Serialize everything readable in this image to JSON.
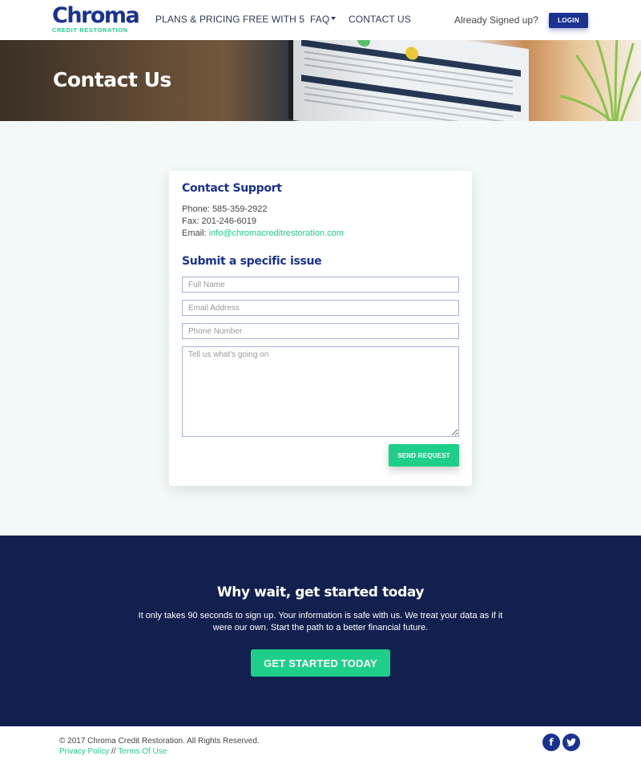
{
  "brand": {
    "name": "Chroma",
    "tagline": "CREDIT RESTORATION",
    "primary_color": "#1b3290",
    "accent_color": "#1ecf8a",
    "dark_color": "#13204f"
  },
  "nav": {
    "items": [
      {
        "label": "PLANS & PRICING"
      },
      {
        "label": "FREE WITH 5"
      },
      {
        "label": "FAQ",
        "has_dropdown": true
      },
      {
        "label": "CONTACT US"
      }
    ],
    "signed_up_text": "Already Signed up?",
    "login_label": "LOGIN"
  },
  "hero": {
    "title": "Contact Us"
  },
  "support": {
    "heading": "Contact Support",
    "phone_label": "Phone:",
    "phone": "585-359-2922",
    "fax_label": "Fax:",
    "fax": "201-246-6019",
    "email_label": "Email:",
    "email": "info@chromacreditrestoration.com"
  },
  "form": {
    "heading": "Submit a specific issue",
    "full_name": {
      "value": "",
      "placeholder": "Full Name"
    },
    "email": {
      "value": "",
      "placeholder": "Email Address"
    },
    "phone": {
      "value": "",
      "placeholder": "Phone Number"
    },
    "message": {
      "value": "",
      "placeholder": "Tell us what's going on"
    },
    "submit_label": "SEND REQUEST"
  },
  "cta": {
    "heading": "Why wait, get started today",
    "body": "It only takes 90 seconds to sign up. Your information is safe with us. We treat your data as if it were our own. Start the path to a better financial future.",
    "button_label": "GET STARTED TODAY"
  },
  "footer": {
    "copyright": "© 2017 Chroma Credit Restoration. All Rights Reserved.",
    "privacy_label": "Privacy Policy",
    "separator": " // ",
    "terms_label": "Terms Of Use",
    "social": [
      {
        "name": "facebook",
        "glyph": "f"
      },
      {
        "name": "twitter",
        "glyph": "t"
      }
    ]
  }
}
